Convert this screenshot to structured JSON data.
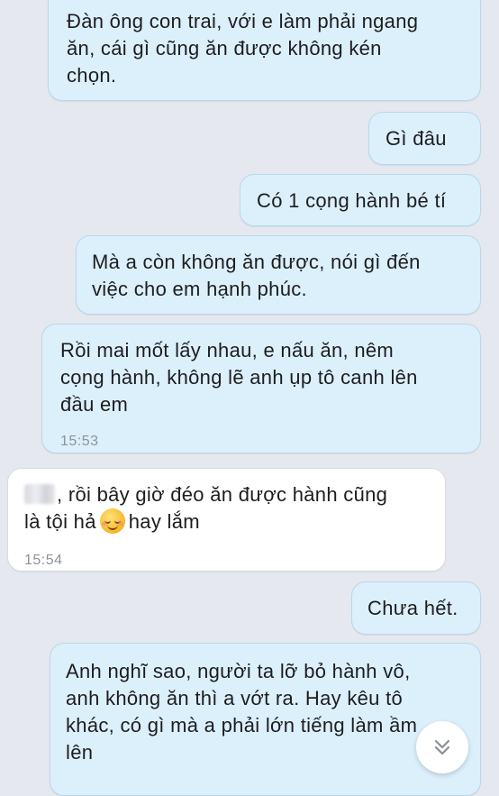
{
  "messages": [
    {
      "text": "Đàn ông con trai, với e làm phải ngang\năn, cái gì cũng ăn được không kén\nchọn."
    },
    {
      "text": "Gì đâu"
    },
    {
      "text": "Có 1 cọng hành bé tí"
    },
    {
      "text": "Mà a còn không ăn được, nói gì đến\nviệc cho em hạnh phúc."
    },
    {
      "text": "Rồi mai mốt lấy nhau, e nấu ăn, nêm\ncọng hành, không lẽ anh ụp tô canh lên\nđầu em",
      "time": "15:53"
    },
    {
      "text_a": ", rồi bây giờ đéo ăn được hành cũng",
      "text_b": "là tội hả",
      "text_c": "hay lắm",
      "time": "15:54",
      "emoji": "smiling-blush-emoji"
    },
    {
      "text": "Chưa hết."
    },
    {
      "text": "Anh nghĩ sao, người ta lỡ bỏ hành vô,\nanh không ăn thì a vớt ra. Hay kêu tô\nkhác, có gì mà a phải lớn tiếng làm ầm\nlên"
    }
  ],
  "scroll_down": {
    "icon": "double-chevron-down-icon"
  },
  "colors": {
    "background": "#e6e8ef",
    "outgoing": "#dcf0fc",
    "incoming": "#ffffff"
  }
}
